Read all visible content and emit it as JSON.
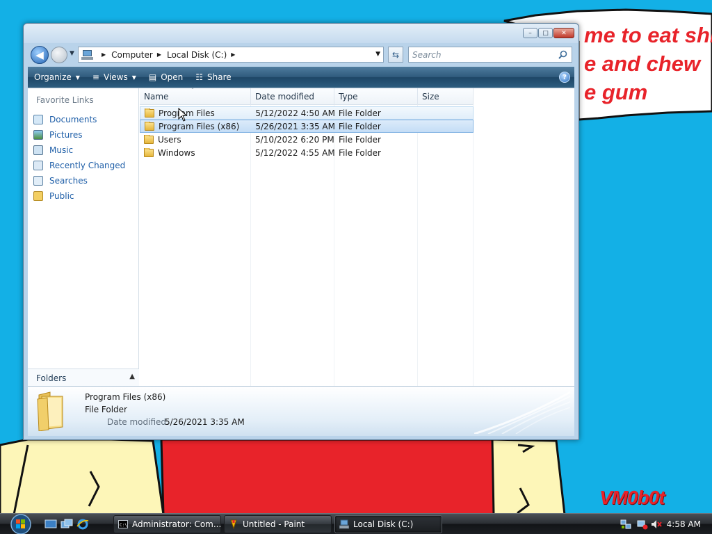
{
  "desktop": {
    "speech_lines": [
      "me to eat shit",
      "e and chew",
      "e gum"
    ],
    "signature": "VM0b0t",
    "colors": {
      "sky": "#13b0e6",
      "red": "#e8232a",
      "yellow": "#fdf6b8"
    }
  },
  "window": {
    "caption_buttons": {
      "minimize": "–",
      "maximize": "□",
      "close": "✕"
    },
    "address": {
      "crumbs": [
        "Computer",
        "Local Disk (C:)"
      ],
      "separator": "▶",
      "dropdown": "▼",
      "refresh_glyph": "⇆"
    },
    "search": {
      "placeholder": "Search"
    },
    "toolbar": {
      "organize": "Organize",
      "views": "Views",
      "open": "Open",
      "share": "Share",
      "caret": "▼",
      "views_glyph": "≡",
      "open_glyph": "▤",
      "share_glyph": "☷",
      "help": "?"
    },
    "navpane": {
      "title": "Favorite Links",
      "items": [
        {
          "label": "Documents",
          "icon": "documents-icon"
        },
        {
          "label": "Pictures",
          "icon": "pictures-icon"
        },
        {
          "label": "Music",
          "icon": "music-icon"
        },
        {
          "label": "Recently Changed",
          "icon": "recently-changed-icon"
        },
        {
          "label": "Searches",
          "icon": "searches-icon"
        },
        {
          "label": "Public",
          "icon": "public-folder-icon"
        }
      ],
      "folders_label": "Folders",
      "folders_chevron": "▲"
    },
    "columns": {
      "name": "Name",
      "date": "Date modified",
      "type": "Type",
      "size": "Size",
      "sort_arrow": "ˆ"
    },
    "files": [
      {
        "name": "Program Files",
        "date": "5/12/2022 4:50 AM",
        "type": "File Folder",
        "size": "",
        "state": "hover"
      },
      {
        "name": "Program Files (x86)",
        "date": "5/26/2021 3:35 AM",
        "type": "File Folder",
        "size": "",
        "state": "selected"
      },
      {
        "name": "Users",
        "date": "5/10/2022 6:20 PM",
        "type": "File Folder",
        "size": "",
        "state": ""
      },
      {
        "name": "Windows",
        "date": "5/12/2022 4:55 AM",
        "type": "File Folder",
        "size": "",
        "state": ""
      }
    ],
    "details": {
      "name": "Program Files (x86)",
      "type": "File Folder",
      "modified_label": "Date modified:",
      "modified_value": "5/26/2021 3:35 AM"
    }
  },
  "taskbar": {
    "buttons": [
      {
        "label": "Administrator: Com...",
        "icon": "command-prompt-icon",
        "active": false
      },
      {
        "label": "Untitled - Paint",
        "icon": "paint-icon",
        "active": false
      },
      {
        "label": "Local Disk (C:)",
        "icon": "explorer-icon",
        "active": true
      }
    ],
    "clock": "4:58 AM"
  }
}
